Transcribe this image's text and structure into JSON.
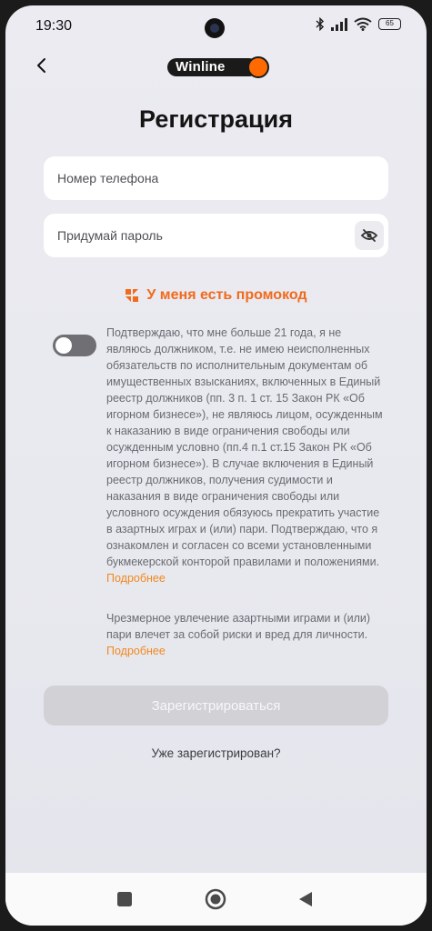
{
  "status_bar": {
    "time": "19:30",
    "battery": "65"
  },
  "header": {
    "logo_text": "Winline",
    "title": "Регистрация"
  },
  "form": {
    "phone_placeholder": "Номер телефона",
    "password_placeholder": "Придумай пароль",
    "promo_label": "У меня есть промокод"
  },
  "consent": {
    "toggle_on": false,
    "text": "Подтверждаю, что мне больше 21 года, я не являюсь должником, т.е. не имею неисполненных обязательств по исполнительным документам об имущественных взысканиях, включенных в Единый реестр должников (пп. 3 п. 1 ст. 15 Закон РК «Об игорном бизнесе»), не являюсь лицом, осужденным к наказанию в виде ограничения свободы или осужденным условно (пп.4 п.1 ст.15 Закон РК «Об игорном бизнесе»). В случае включения в Единый реестр должников, получения судимости и наказания в виде ограничения свободы или условного осуждения обязуюсь прекратить участие в азартных играх и (или) пари. Подтверждаю, что я ознакомлен и согласен со всеми установленными букмекерской конторой правилами и положениями.",
    "more_label": "Подробнее"
  },
  "warning": {
    "text": "Чрезмерное увлечение азартными играми и (или) пари влечет за собой риски и вред для личности.",
    "more_label": "Подробнее"
  },
  "actions": {
    "register_label": "Зарегистрироваться",
    "login_label": "Уже зарегистрирован?"
  },
  "colors": {
    "accent": "#f26a1c",
    "link": "#f0891f",
    "logo_dot": "#ff6a00",
    "button_disabled": "#d1d1d6"
  },
  "icons": [
    "back-arrow-icon",
    "bluetooth-icon",
    "signal-icon",
    "wifi-icon",
    "battery-icon",
    "eye-off-icon",
    "promo-logo-icon",
    "nav-square-icon",
    "nav-home-icon",
    "nav-back-icon"
  ]
}
